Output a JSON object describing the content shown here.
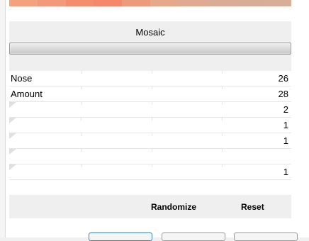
{
  "preview": {
    "colors": [
      "#f2a37e",
      "#f39878",
      "#f58c6c",
      "#f7876a",
      "#ed9a7c",
      "#e5a88a",
      "#dfaa91",
      "#dbac95",
      "#d8ad97",
      "#d9ae99"
    ]
  },
  "filter": {
    "title": "Mosaic",
    "slider_fill_fraction": 1.0
  },
  "params": [
    {
      "label": "Nose",
      "value": "26"
    },
    {
      "label": "Amount",
      "value": "28"
    },
    {
      "label": "",
      "value": "2"
    },
    {
      "label": "",
      "value": "1"
    },
    {
      "label": "",
      "value": "1"
    },
    {
      "label": "",
      "value": ""
    },
    {
      "label": "",
      "value": "1"
    }
  ],
  "actions": {
    "randomize_label": "Randomize",
    "reset_label": "Reset"
  }
}
